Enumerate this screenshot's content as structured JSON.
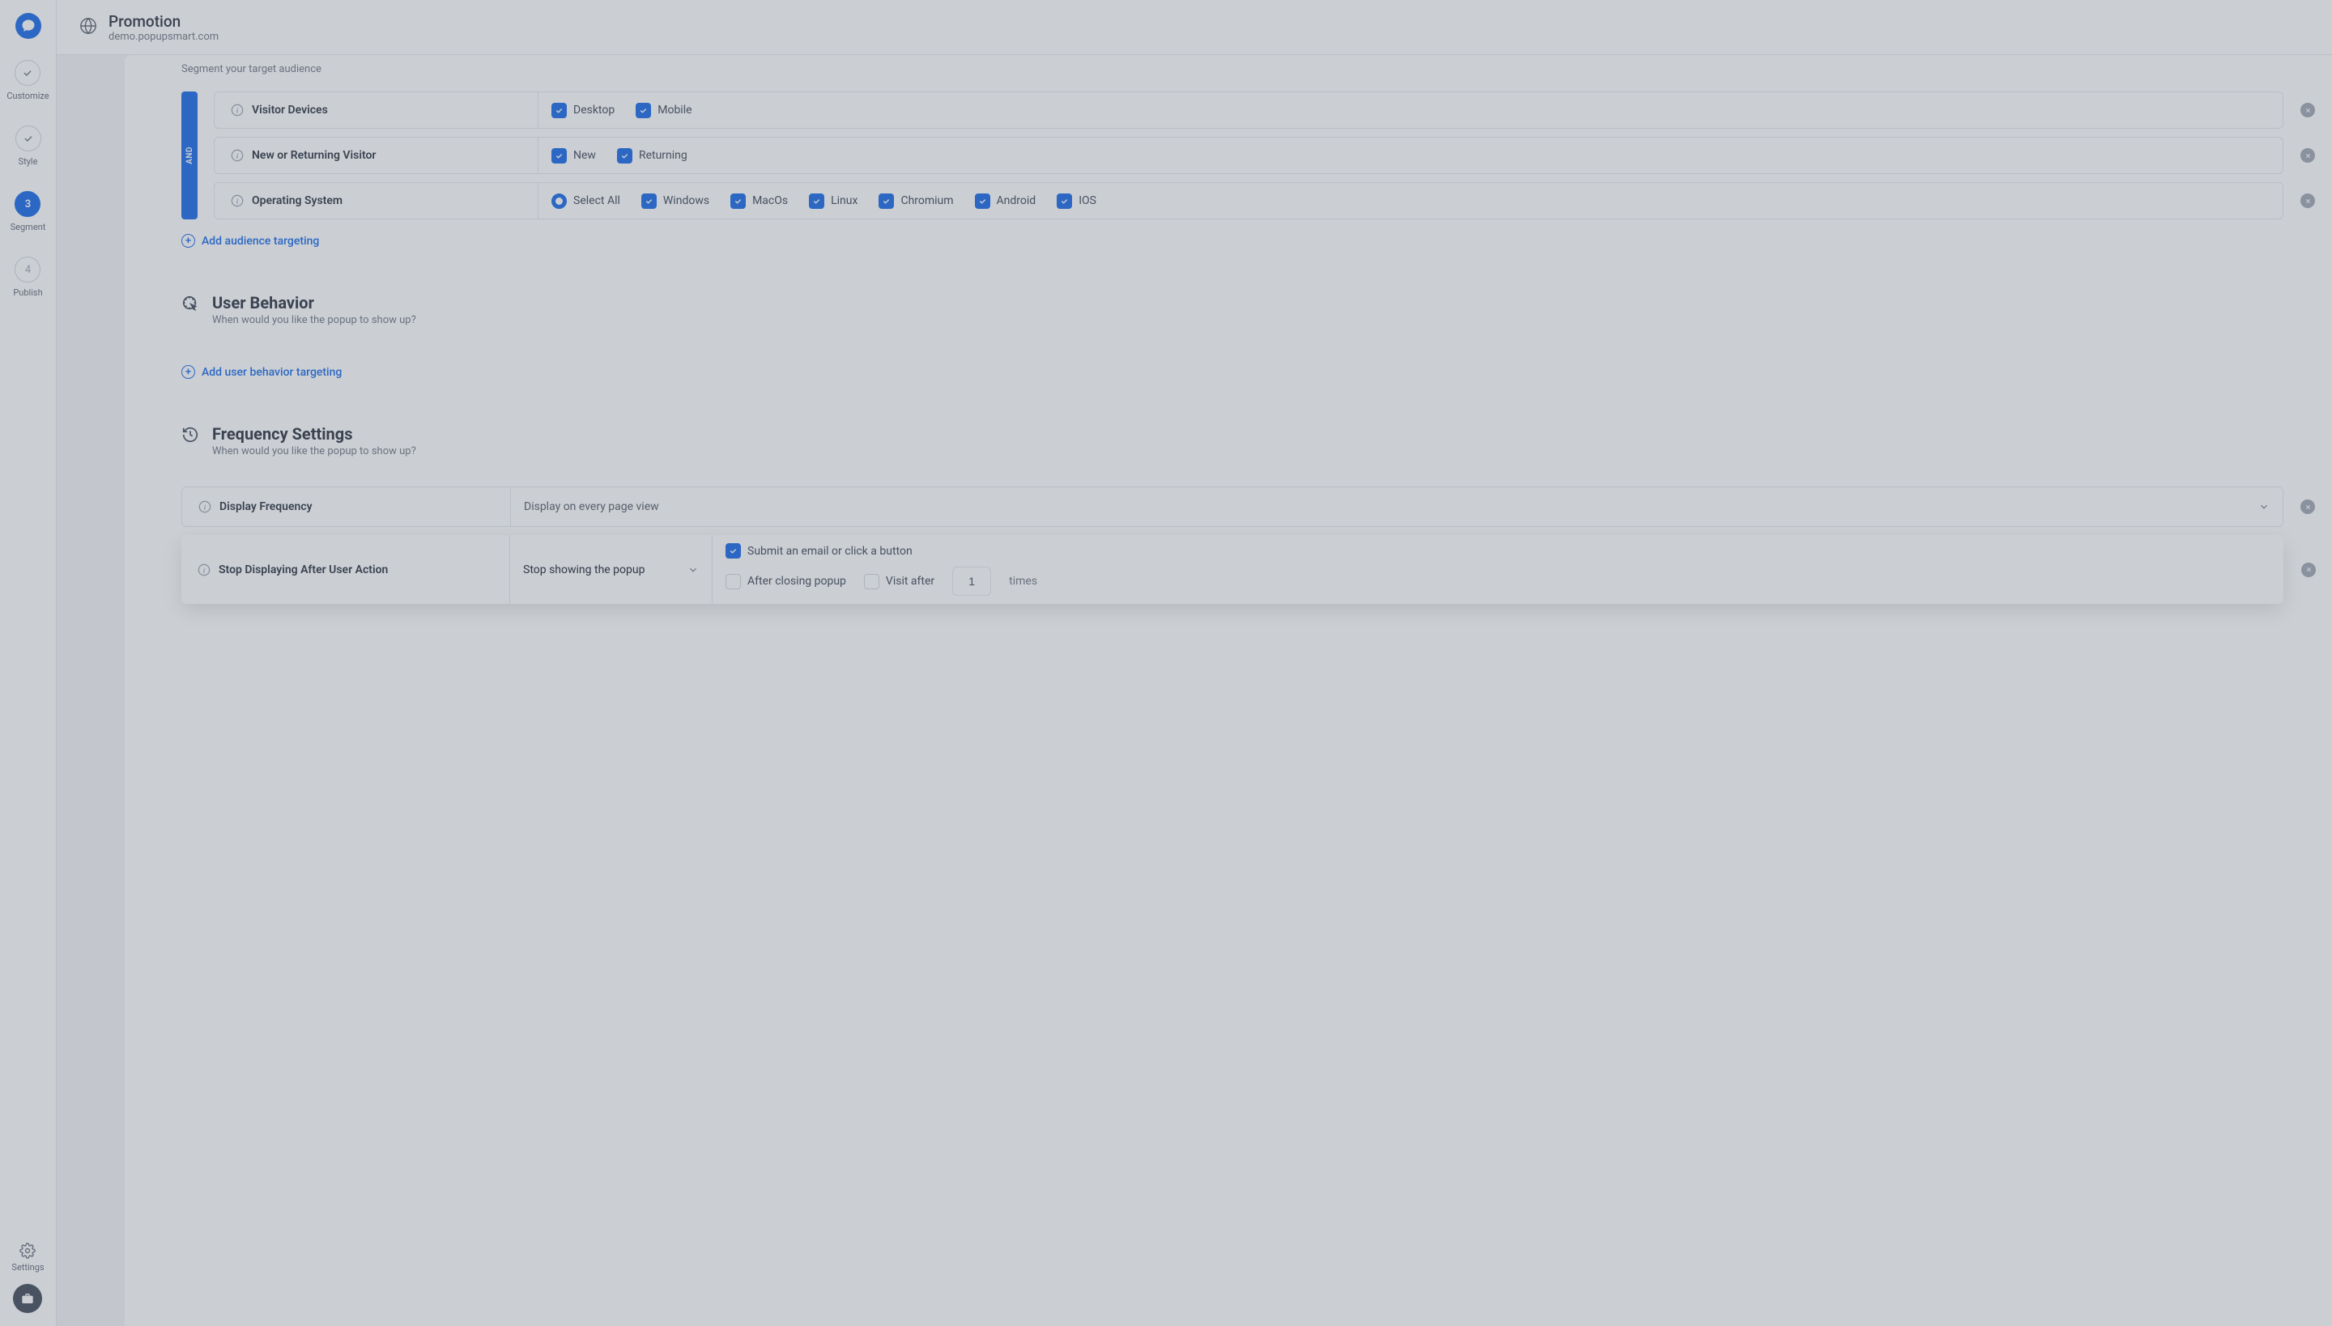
{
  "sidebar": {
    "steps": [
      {
        "label": "Customize"
      },
      {
        "label": "Style"
      },
      {
        "num": "3",
        "label": "Segment"
      },
      {
        "num": "4",
        "label": "Publish"
      }
    ],
    "settings_label": "Settings"
  },
  "header": {
    "title": "Promotion",
    "subtitle": "demo.popupsmart.com"
  },
  "audience": {
    "subtitle": "Segment your target audience",
    "and_label": "AND",
    "rows": [
      {
        "label": "Visitor Devices",
        "options": [
          "Desktop",
          "Mobile"
        ]
      },
      {
        "label": "New or Returning Visitor",
        "options": [
          "New",
          "Returning"
        ]
      },
      {
        "label": "Operating System",
        "select_all": "Select All",
        "options": [
          "Windows",
          "MacOs",
          "Linux",
          "Chromium",
          "Android",
          "IOS"
        ]
      }
    ],
    "add_link": "Add audience targeting"
  },
  "behavior": {
    "title": "User Behavior",
    "subtitle": "When would you like the popup to show up?",
    "add_link": "Add user behavior targeting"
  },
  "frequency": {
    "title": "Frequency Settings",
    "subtitle": "When would you like the popup to show up?",
    "display_label": "Display Frequency",
    "display_value": "Display on every page view",
    "stop_label": "Stop Displaying After User Action",
    "stop_value": "Stop showing the popup",
    "submit_label": "Submit an email or click a button",
    "after_close_label": "After closing popup",
    "visit_after_label": "Visit after",
    "visit_after_value": "1",
    "times_label": "times"
  }
}
